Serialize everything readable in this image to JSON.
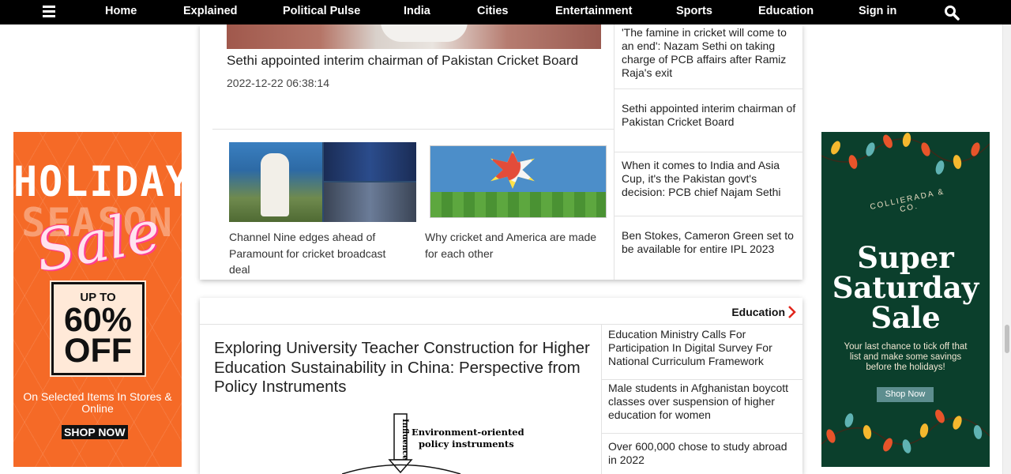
{
  "nav": {
    "items": [
      "Home",
      "Explained",
      "Political Pulse",
      "India",
      "Cities",
      "Entertainment",
      "Sports",
      "Education",
      "Sign in"
    ]
  },
  "icons": {
    "menu": "hamburger-menu-icon",
    "search": "search-icon",
    "chevron": "chevron-right-icon"
  },
  "colors": {
    "nav_bg": "#000000",
    "accent_red": "#e1261c",
    "ad_left_bg": "#f56a27",
    "ad_right_bg": "#0b3f2c"
  },
  "ad_left": {
    "line1": "HOLIDAY",
    "line2": "SEASON",
    "script": "Sale",
    "upto": "UP TO",
    "percent": "60%",
    "off": "OFF",
    "selected": "On Selected Items In Stores & Online",
    "cta": "SHOP NOW"
  },
  "ad_right": {
    "brand": "COLLIERADA & CO.",
    "headline1": "Super",
    "headline2": "Saturday",
    "headline3": "Sale",
    "body": "Your last chance to tick off that list and make some savings before the holidays!",
    "cta": "Shop Now"
  },
  "sports": {
    "hero_title": "Sethi appointed interim chairman of Pakistan Cricket Board",
    "hero_date": "2022-12-22 06:38:14",
    "captions": [
      "Channel Nine edges ahead of Paramount for cricket broadcast deal",
      "Why cricket and America are made for each other"
    ],
    "side_list": [
      "'The famine in cricket will come to an end': Nazam Sethi on taking charge of PCB affairs after Ramiz Raja's exit",
      "Sethi appointed interim chairman of Pakistan Cricket Board",
      "When it comes to India and Asia Cup, it's the Pakistan govt's decision: PCB chief Najam Sethi",
      "Ben Stokes, Cameron Green set to be available for entire IPL 2023"
    ]
  },
  "education": {
    "section_label": "Education",
    "headline": "Exploring University Teacher Construction for Higher Education Sustainability in China: Perspective from Policy Instruments",
    "diagram_labels": {
      "arrow": "Influence",
      "box": "Environment-oriented policy instruments"
    },
    "side_list": [
      "Education Ministry Calls For Participation In Digital Survey For National Curriculum Framework",
      "Male students in Afghanistan boycott classes over suspension of higher education for women",
      "Over 600,000 chose to study abroad in 2022"
    ]
  }
}
